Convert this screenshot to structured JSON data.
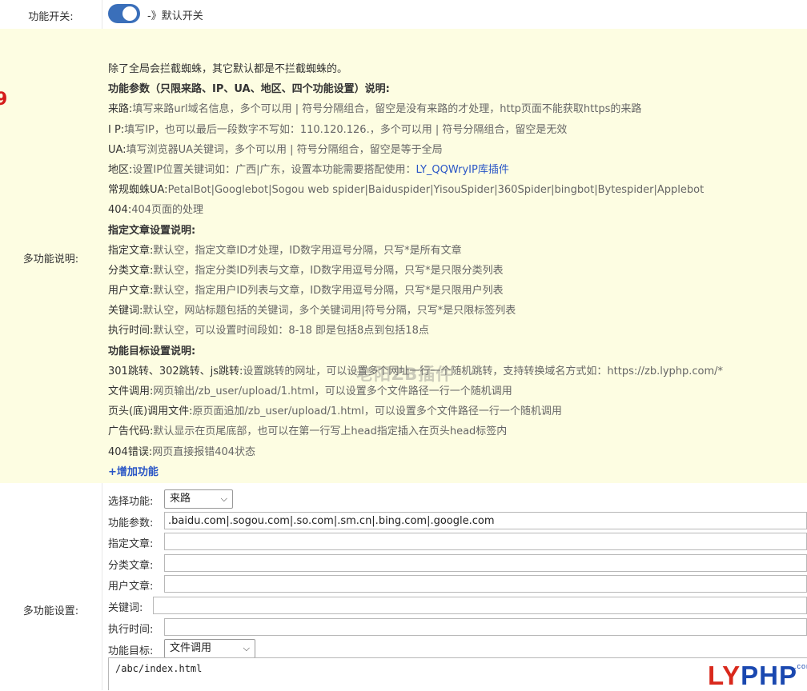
{
  "switch_row": {
    "label": "功能开关:",
    "toggle_on": true,
    "toggle_text": "-》默认开关"
  },
  "desc_row": {
    "label": "多功能说明:",
    "lines": [
      {
        "k": "除了全局会拦截蜘蛛，其它默认都是不拦截蜘蛛的。",
        "v": ""
      },
      {
        "h": "功能参数（只限来路、IP、UA、地区、四个功能设置）说明:"
      },
      {
        "k": "来路:",
        "v": "填写来路url域名信息，多个可以用 | 符号分隔组合，留空是没有来路的才处理，http页面不能获取https的来路"
      },
      {
        "k": "I P:",
        "v": "填写IP，也可以最后一段数字不写如：110.120.126.，多个可以用 | 符号分隔组合，留空是无效"
      },
      {
        "k": "UA:",
        "v": "填写浏览器UA关键词，多个可以用 | 符号分隔组合，留空是等于全局"
      },
      {
        "k": "地区:",
        "v": "设置IP位置关键词如：广西|广东，设置本功能需要搭配使用：",
        "link": "LY_QQWryIP库插件"
      },
      {
        "k": "常规蜘蛛UA:",
        "v": "PetalBot|Googlebot|Sogou web spider|Baiduspider|YisouSpider|360Spider|bingbot|Bytespider|Applebot"
      },
      {
        "k": "404:",
        "v": "404页面的处理"
      },
      {
        "h": "指定文章设置说明:"
      },
      {
        "k": "指定文章:",
        "v": "默认空，指定文章ID才处理，ID数字用逗号分隔，只写*是所有文章"
      },
      {
        "k": "分类文章:",
        "v": "默认空，指定分类ID列表与文章，ID数字用逗号分隔，只写*是只限分类列表"
      },
      {
        "k": "用户文章:",
        "v": "默认空，指定用户ID列表与文章，ID数字用逗号分隔，只写*是只限用户列表"
      },
      {
        "k": "关键词:",
        "v": "默认空，网站标题包括的关键词，多个关键词用|符号分隔，只写*是只限标签列表"
      },
      {
        "k": "执行时间:",
        "v": "默认空，可以设置时间段如：8-18 即是包括8点到包括18点"
      },
      {
        "h": "功能目标设置说明:"
      },
      {
        "k": "301跳转、302跳转、js跳转:",
        "v": "设置跳转的网址，可以设置多个网址一行一个随机跳转，支持转换域名方式如：https://zb.lyphp.com/*"
      },
      {
        "k": "文件调用:",
        "v": "网页输出/zb_user/upload/1.html，可以设置多个文件路径一行一个随机调用"
      },
      {
        "k": "页头(底)调用文件:",
        "v": "原页面追加/zb_user/upload/1.html，可以设置多个文件路径一行一个随机调用"
      },
      {
        "k": "广告代码:",
        "v": "默认显示在页尾底部，也可以在第一行写上head指定插入在页头head标签内"
      },
      {
        "k": "404错误:",
        "v": "网页直接报错404状态"
      }
    ],
    "add_link": "+增加功能",
    "red_mark": "9"
  },
  "settings_row": {
    "label": "多功能设置:",
    "fields": {
      "select_function": {
        "label": "选择功能:",
        "value": "来路"
      },
      "function_params": {
        "label": "功能参数:",
        "value": ".baidu.com|.sogou.com|.so.com|.sm.cn|.bing.com|.google.com"
      },
      "specified_posts": {
        "label": "指定文章:",
        "value": ""
      },
      "category_posts": {
        "label": "分类文章:",
        "value": ""
      },
      "user_posts": {
        "label": "用户文章:",
        "value": ""
      },
      "keywords": {
        "label": "关键词:",
        "value": ""
      },
      "exec_time": {
        "label": "执行时间:",
        "value": ""
      },
      "function_target": {
        "label": "功能目标:",
        "value": "文件调用"
      },
      "target_content": {
        "value": "/abc/index.html"
      }
    }
  },
  "watermark": "老阳ZB插件",
  "brand": {
    "ly": "LY",
    "php": "PHP",
    "dot": ".com"
  },
  "colors": {
    "accent": "#3a6fba",
    "desc_bg": "#fdfde2",
    "link": "#2a56c6",
    "brand_red": "#d9281c",
    "brand_blue": "#1a48b0"
  }
}
